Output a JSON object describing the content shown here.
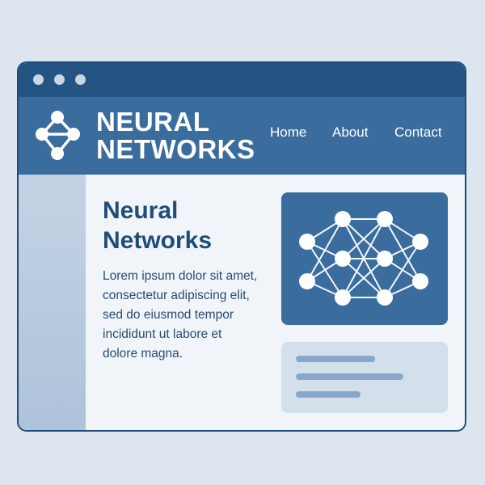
{
  "window": {
    "controls": [
      "window-dot-1",
      "window-dot-2",
      "window-dot-3"
    ]
  },
  "header": {
    "brand_line1": "NEURAL",
    "brand_line2": "NETWORKS",
    "nav": {
      "home": "Home",
      "about": "About",
      "contact": "Contact"
    },
    "logo_icon": "network-graph-icon"
  },
  "main": {
    "heading_line1": "Neural",
    "heading_line2": "Networks",
    "paragraph_lines": [
      "Lorem ipsum dolor sit amet,",
      "consectetur adipiscing elit,",
      "sed do eiusmod tempor",
      "incididunt ut labore et",
      "dolore magna."
    ],
    "image_icon": "neural-network-diagram-icon",
    "text_placeholder": "text-placeholder-lines"
  },
  "colors": {
    "page_background": "#dde6ef",
    "titlebar": "#245483",
    "header": "#3a6c9e",
    "heading_text": "#1f4c78",
    "sidebar": "#b6cadf",
    "placeholder_card": "#d3dfeb",
    "placeholder_bar": "#89a8c8"
  }
}
